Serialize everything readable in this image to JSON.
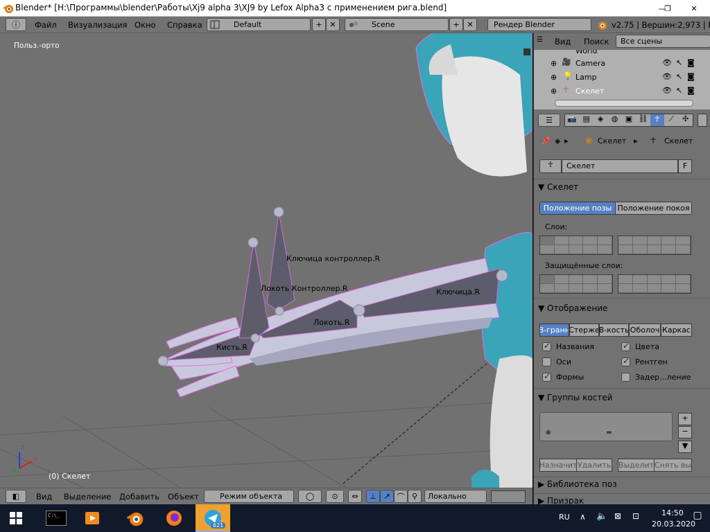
{
  "titlebar": {
    "title": "Blender* [H:\\Программы\\blender\\Работы\\Xj9 alpha 3\\XJ9 by Lefox Alpha3 с применением рига.blend]",
    "minimize": "—",
    "maximize": "❐",
    "close": "✕"
  },
  "menubar": {
    "menus": [
      "Файл",
      "Визуализация",
      "Окно",
      "Справка"
    ],
    "layout": "Default",
    "scene": "Scene",
    "render_engine": "Рендер Blender",
    "stats": "v2.75 | Вершин:2,973 | Гр"
  },
  "viewport": {
    "view_label": "Польз.-орто",
    "status": "(0) Скелет",
    "bones": [
      "Ключица контроллер.R",
      "Локоть Контроллер.R",
      "Ключица.R",
      "Локоть.R",
      "Кисть.R"
    ],
    "axis_x": "x",
    "axis_z": "z"
  },
  "header3d": {
    "view": "Вид",
    "select": "Выделение",
    "add": "Добавить",
    "object": "Объект",
    "mode": "Режим объекта",
    "pivot": "Локально"
  },
  "outliner": {
    "menu_view": "Вид",
    "menu_search": "Поиск",
    "scope": "Все сцены",
    "items": [
      {
        "name": "World"
      },
      {
        "name": "Camera"
      },
      {
        "name": "Lamp"
      },
      {
        "name": "Скелет"
      }
    ]
  },
  "properties": {
    "breadcrumb_object": "Скелет",
    "breadcrumb_data": "Скелет",
    "datablock_name": "Скелет",
    "fake_user": "F",
    "panel_skeleton": "Скелет",
    "pose_position": "Положение позы",
    "rest_position": "Положение покоя",
    "layers_label": "Слои:",
    "protected_layers_label": "Защищённые слои:",
    "panel_display": "Отображение",
    "display_types": [
      "8-гранн",
      "Стерже",
      "В-кость",
      "Оболоч",
      "Каркас"
    ],
    "options": [
      {
        "label": "Названия",
        "checked": true
      },
      {
        "label": "Цвета",
        "checked": true
      },
      {
        "label": "Оси",
        "checked": false
      },
      {
        "label": "Рентген",
        "checked": true
      },
      {
        "label": "Формы",
        "checked": true
      },
      {
        "label": "Задер...ление",
        "checked": false
      }
    ],
    "panel_bone_groups": "Группы костей",
    "assign": "Назначит",
    "remove": "Удалить",
    "select": "Выделит",
    "deselect": "Снять вы",
    "panel_pose_library": "Библиотека поз",
    "panel_ghost": "Призрак"
  },
  "taskbar": {
    "lang": "RU",
    "time": "14:50",
    "date": "20.03.2020",
    "telegram_badge": "621"
  },
  "colors": {
    "accent_blue": "#5680c2",
    "viewport_bg": "#717171",
    "character_teal": "#3aa4b8",
    "bone_outline": "#e36fe6"
  }
}
